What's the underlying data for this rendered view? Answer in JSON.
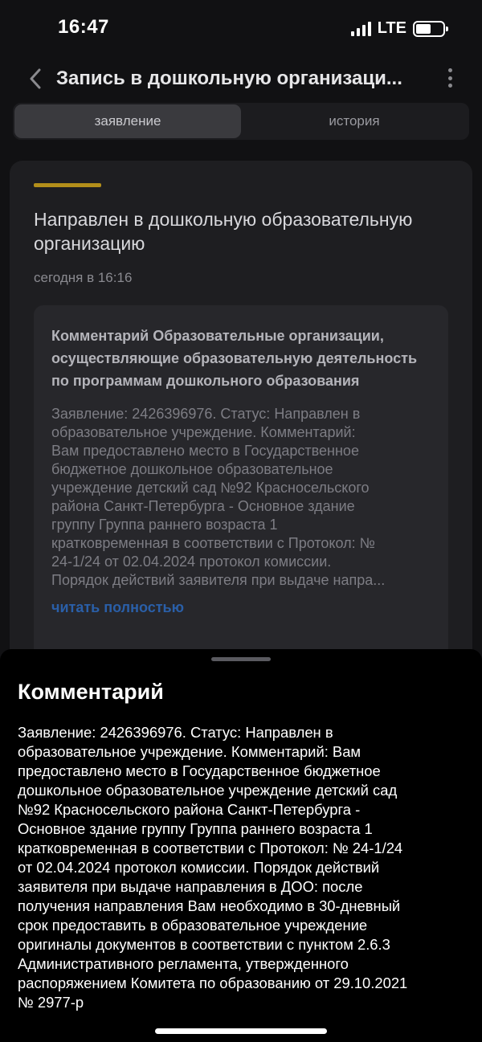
{
  "status_bar": {
    "time": "16:47",
    "network": "LTE"
  },
  "header": {
    "title": "Запись в дошкольную организаци...",
    "back_icon": "chevron-left-icon",
    "menu_icon": "more-vertical-icon"
  },
  "tabs": [
    {
      "label": "заявление",
      "active": true
    },
    {
      "label": "история",
      "active": false
    }
  ],
  "card": {
    "accent_color": "#b38f1a",
    "title": "Направлен в дошкольную образовательную организацию",
    "time": "сегодня в 16:16",
    "comment": {
      "heading": "Комментарий Образовательные организации, осуществляющие образовательную деятельность по программам дошкольного образования",
      "body": "Заявление: 2426396976. Статус: Направлен в\nобразовательное учреждение. Комментарий:\nВам предоставлено место в Государственное\nбюджетное дошкольное образовательное\nучреждение детский сад №92 Красносельского\nрайона Санкт-Петербурга - Основное здание\nгруппу Группа раннего возраста 1\nкратковременная в соответствии с Протокол: №\n24-1/24 от 02.04.2024 протокол комиссии.\nПорядок действий заявителя при выдаче напра...",
      "read_more": "читать полностью"
    }
  },
  "sheet": {
    "title": "Комментарий",
    "body": "Заявление: 2426396976. Статус: Направлен в\nобразовательное учреждение. Комментарий: Вам\nпредоставлено место в Государственное бюджетное\nдошкольное образовательное учреждение детский сад\n№92 Красносельского района Санкт-Петербурга -\nОсновное здание группу Группа раннего возраста 1\nкратковременная в соответствии с Протокол: № 24-1/24\nот 02.04.2024 протокол комиссии. Порядок действий\nзаявителя при выдаче направления в ДОО: после\nполучения направления Вам необходимо в 30-дневный\nсрок предоставить в образовательное учреждение\nоригиналы документов в соответствии с пунктом 2.6.3\nАдминистративного регламента, утвержденного\nраспоряжением Комитета по образованию от 29.10.2021\n№ 2977-р"
  }
}
